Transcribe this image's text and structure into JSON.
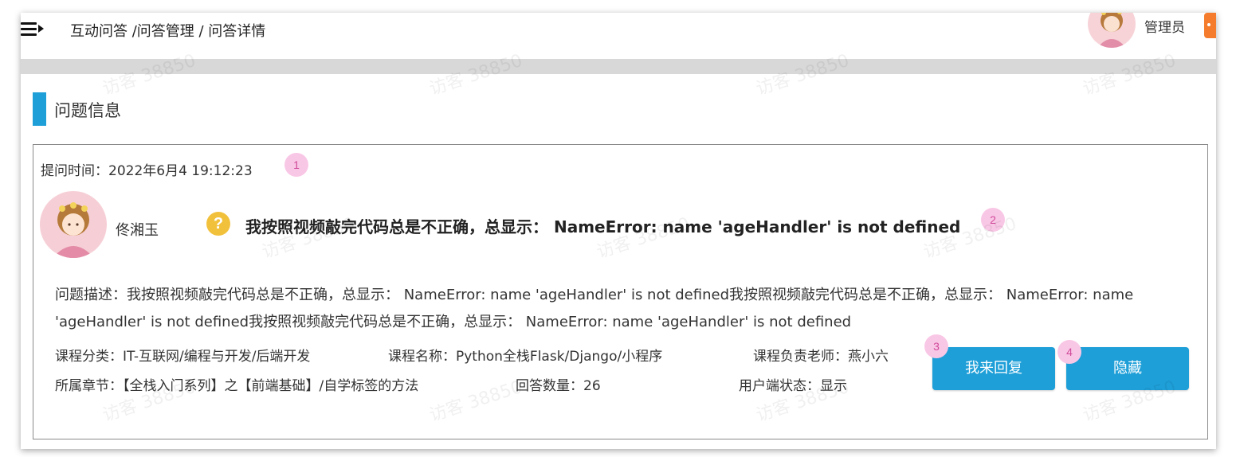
{
  "header": {
    "breadcrumb": "互动问答 /问答管理 / 问答详情",
    "admin_name": "管理员"
  },
  "section": {
    "title": "问题信息"
  },
  "question": {
    "ask_time": "提问时间：2022年6月4 19:12:23",
    "user_name": "佟湘玉",
    "icon_glyph": "?",
    "title": "我按照视频敲完代码总是不正确，总显示： NameError: name 'ageHandler' is not defined",
    "description": "问题描述：我按照视频敲完代码总是不正确，总显示： NameError: name 'ageHandler' is not defined我按照视频敲完代码总是不正确，总显示： NameError: name 'ageHandler' is not defined我按照视频敲完代码总是不正确，总显示： NameError: name 'ageHandler' is not defined"
  },
  "info": {
    "category": "课程分类：IT-互联网/编程与开发/后端开发",
    "course_name": "课程名称：Python全栈Flask/Django/小程序",
    "teacher": "课程负责老师：燕小六",
    "chapter": "所属章节：【全栈入门系列】之【前端基础】/自学标签的方法",
    "answer_count": "回答数量：26",
    "user_status": "用户端状态：显示"
  },
  "buttons": {
    "reply": "我来回复",
    "hide": "隐藏"
  },
  "markers": [
    "1",
    "2",
    "3",
    "4"
  ],
  "watermark": "访客 38850",
  "colors": {
    "accent": "#1e9fd8",
    "question_icon": "#f2c13c",
    "marker": "#f9c7e6",
    "header_badge": "#f47c2c"
  },
  "icons": {
    "menu": "menu-toggle-icon",
    "question": "question-mark-icon",
    "avatar": "avatar-illustration"
  }
}
